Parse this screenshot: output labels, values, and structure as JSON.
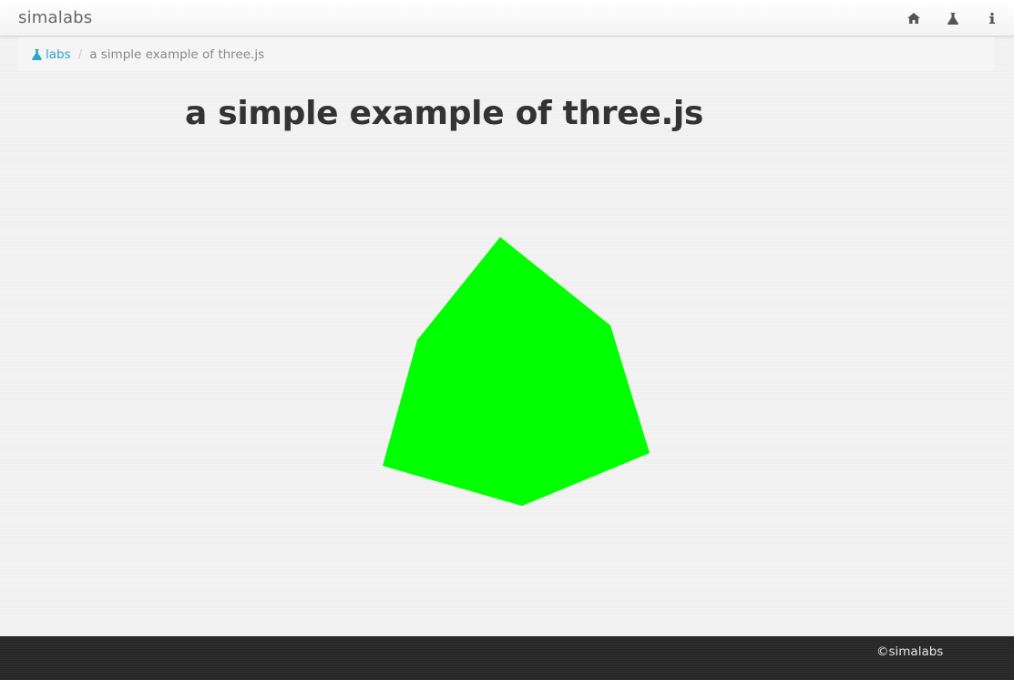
{
  "navbar": {
    "brand": "simalabs",
    "icons": [
      "home-icon",
      "flask-icon",
      "info-icon"
    ]
  },
  "breadcrumb": {
    "link_label": "labs",
    "current": "a simple example of three.js"
  },
  "main": {
    "title": "a simple example of three.js",
    "scene_object": "green-rotating-cube",
    "object_color": "#00ff00"
  },
  "footer": {
    "copyright": "©simalabs"
  },
  "colors": {
    "accent": "#2ba6cb",
    "footer_bg": "#2c2c2c"
  }
}
